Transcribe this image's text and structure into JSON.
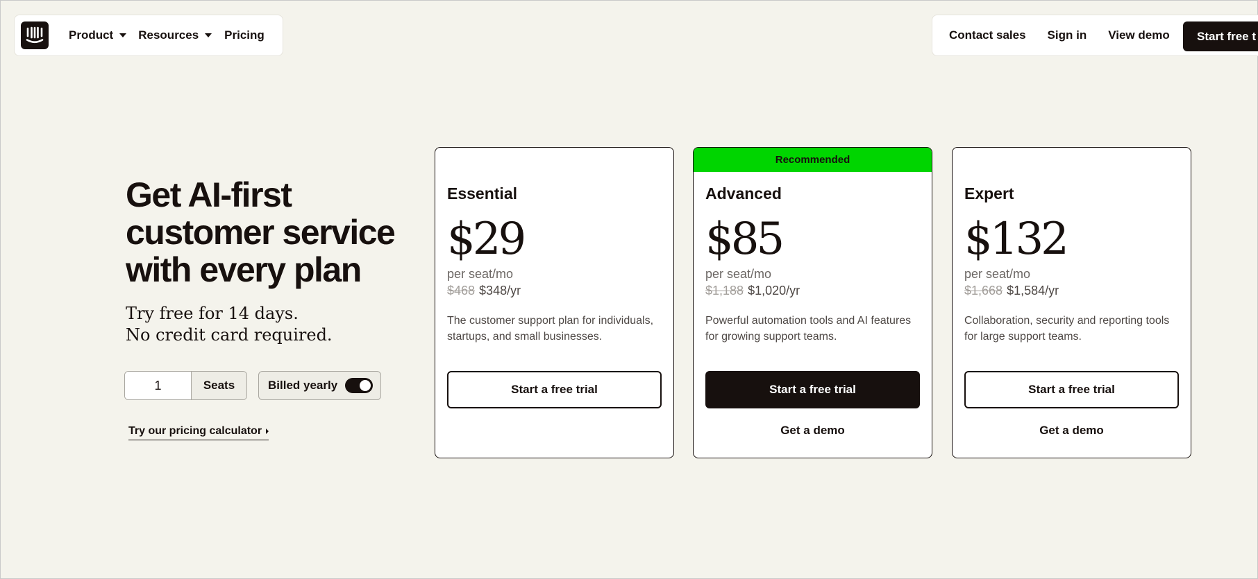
{
  "nav": {
    "logo_icon": "intercom-logo-icon",
    "product": "Product",
    "resources": "Resources",
    "pricing": "Pricing",
    "contact_sales": "Contact sales",
    "sign_in": "Sign in",
    "view_demo": "View demo",
    "start_free_trial": "Start free t"
  },
  "hero": {
    "title": "Get AI-first\ncustomer service\nwith every plan",
    "subtitle": "Try free for 14 days.\nNo credit card required.",
    "seats_value": "1",
    "seats_label": "Seats",
    "billing_label": "Billed yearly",
    "billing_yearly_on": true,
    "calculator_link": "Try our pricing calculator"
  },
  "plans": [
    {
      "name": "Essential",
      "price": "$29",
      "per": "per seat/mo",
      "old_yearly": "$468",
      "yearly": "$348/yr",
      "description": "The customer support plan for individuals, startups, and small businesses.",
      "cta": "Start a free trial"
    },
    {
      "badge": "Recommended",
      "name": "Advanced",
      "price": "$85",
      "per": "per seat/mo",
      "old_yearly": "$1,188",
      "yearly": "$1,020/yr",
      "description": "Powerful automation tools and AI features for growing support teams.",
      "cta": "Start a free trial",
      "secondary": "Get a demo"
    },
    {
      "name": "Expert",
      "price": "$132",
      "per": "per seat/mo",
      "old_yearly": "$1,668",
      "yearly": "$1,584/yr",
      "description": "Collaboration, security and reporting tools for large support teams.",
      "cta": "Start a free trial",
      "secondary": "Get a demo"
    }
  ],
  "colors": {
    "background": "#f4f3ec",
    "ink": "#17100e",
    "recommended": "#00d500"
  }
}
